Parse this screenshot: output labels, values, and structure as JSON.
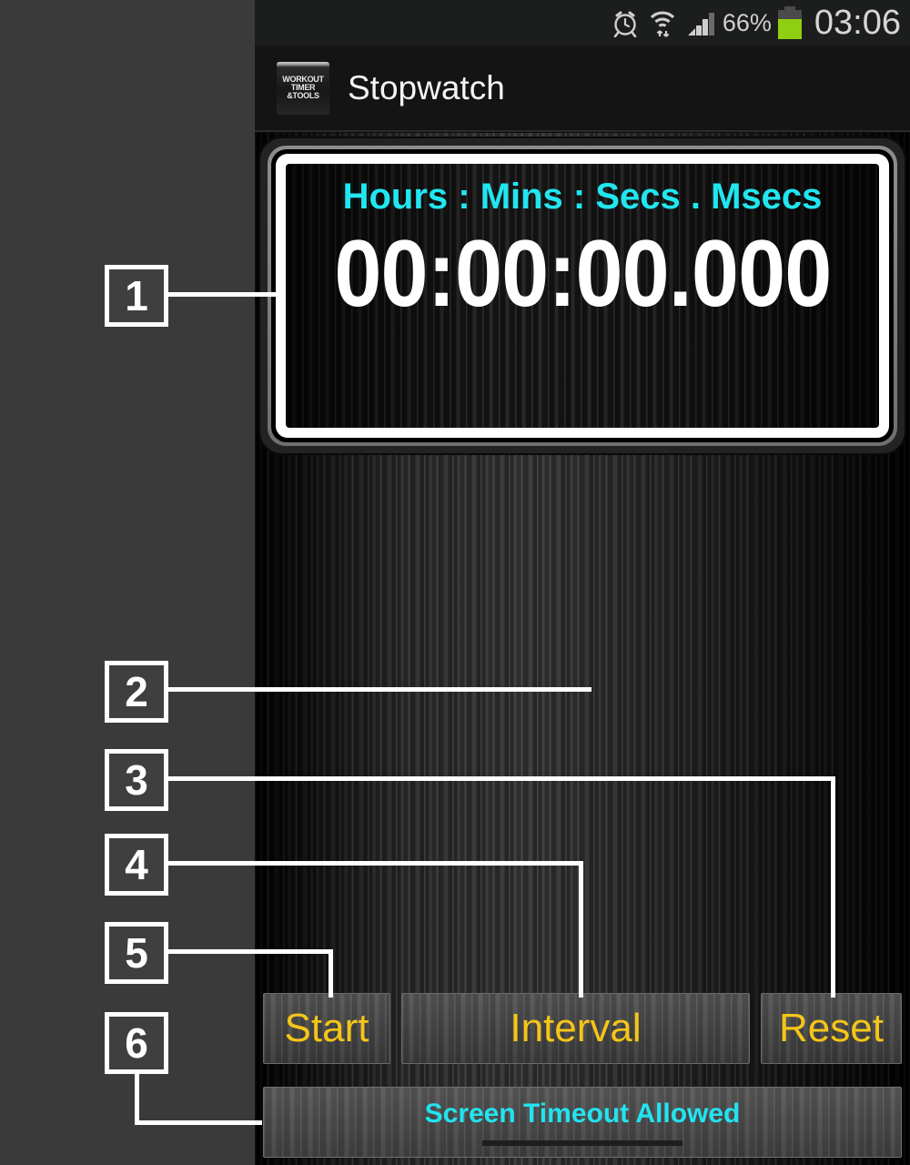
{
  "statusbar": {
    "icons": [
      "alarm-clock-icon",
      "wifi-icon",
      "signal-icon"
    ],
    "battery_percent": "66%",
    "clock": "03:06"
  },
  "actionbar": {
    "app_icon_lines": [
      "WORKOUT",
      "TIMER",
      "&TOOLS"
    ],
    "title": "Stopwatch"
  },
  "display": {
    "label": "Hours : Mins : Secs . Msecs",
    "time": "00:00:00.000"
  },
  "buttons": {
    "start": "Start",
    "interval": "Interval",
    "reset": "Reset"
  },
  "timeout": {
    "label": "Screen Timeout Allowed"
  },
  "annotations": {
    "markers": [
      {
        "id": "1",
        "label": "1"
      },
      {
        "id": "2",
        "label": "2"
      },
      {
        "id": "3",
        "label": "3"
      },
      {
        "id": "4",
        "label": "4"
      },
      {
        "id": "5",
        "label": "5"
      },
      {
        "id": "6",
        "label": "6"
      }
    ]
  },
  "colors": {
    "accent_cyan": "#21e6f0",
    "button_amber": "#f5c518",
    "battery_green": "#8fcf12",
    "gutter_gray": "#3a3a3a",
    "marker_white": "#ffffff"
  }
}
